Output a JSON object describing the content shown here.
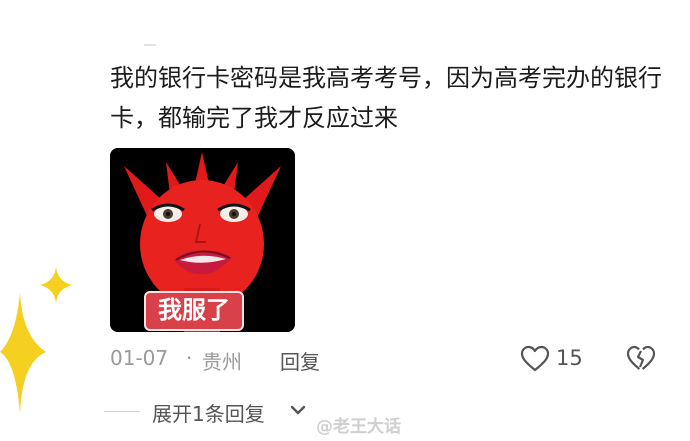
{
  "comment": {
    "text": "我的银行卡密码是我高考考号，因为高考完办的银行卡，都输完了我才反应过来"
  },
  "sticker": {
    "caption": "我服了"
  },
  "meta": {
    "date": "01-07",
    "separator": "·",
    "location": "贵州",
    "reply_label": "回复"
  },
  "actions": {
    "like_count": "15",
    "like_icon": "heart-outline-icon",
    "dislike_icon": "broken-heart-icon"
  },
  "replies": {
    "expand_label": "展开1条回复",
    "chevron_icon": "chevron-down-icon"
  },
  "watermark": {
    "text": "@老王大话"
  },
  "colors": {
    "text_primary": "#1c1c1c",
    "text_secondary": "#9a9a9a",
    "accent_red": "#e02222",
    "sparkle_yellow": "#f5d020"
  }
}
